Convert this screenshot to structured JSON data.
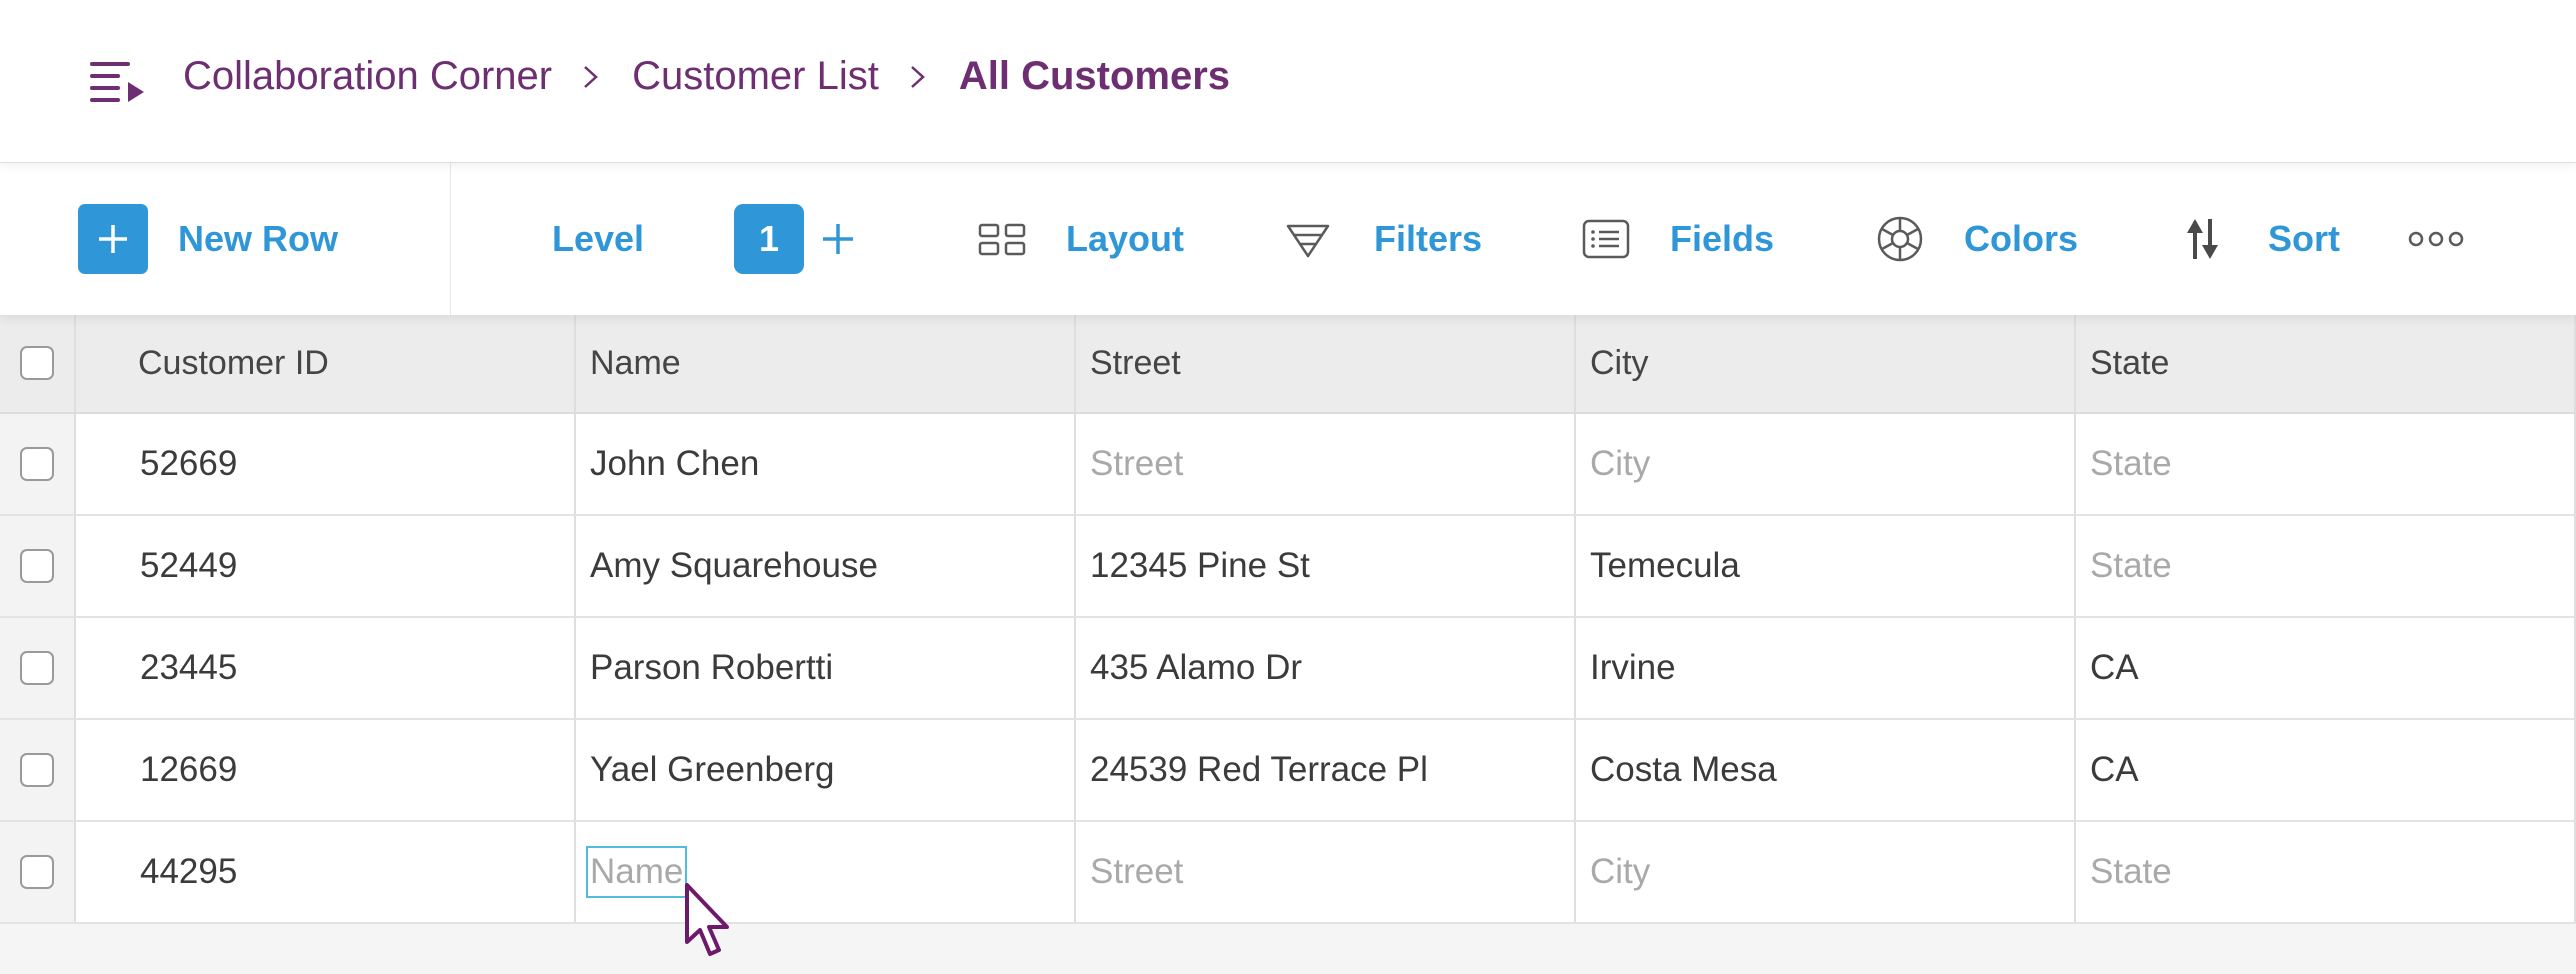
{
  "breadcrumb": {
    "items": [
      "Collaboration Corner",
      "Customer List",
      "All Customers"
    ]
  },
  "toolbar": {
    "new_row": "New Row",
    "level": "Level",
    "level_value": "1",
    "layout": "Layout",
    "filters": "Filters",
    "fields": "Fields",
    "colors": "Colors",
    "sort": "Sort",
    "more_icon": "more-horizontal-icon"
  },
  "table": {
    "columns": [
      "Customer ID",
      "Name",
      "Street",
      "City",
      "State"
    ],
    "placeholders": {
      "name": "Name",
      "street": "Street",
      "city": "City",
      "state": "State"
    },
    "rows": [
      {
        "id": "52669",
        "name": "John Chen",
        "street": "",
        "city": "",
        "state": ""
      },
      {
        "id": "52449",
        "name": "Amy Squarehouse",
        "street": "12345 Pine St",
        "city": "Temecula",
        "state": ""
      },
      {
        "id": "23445",
        "name": "Parson Robertti",
        "street": "435 Alamo Dr",
        "city": "Irvine",
        "state": "CA"
      },
      {
        "id": "12669",
        "name": "Yael Greenberg",
        "street": "24539 Red Terrace Pl",
        "city": "Costa Mesa",
        "state": "CA"
      },
      {
        "id": "44295",
        "name": "",
        "street": "",
        "city": "",
        "state": ""
      }
    ]
  },
  "colors": {
    "accent": "#2f97d8",
    "breadcrumb": "#6d2e72",
    "editing_border": "#53bcd8"
  }
}
